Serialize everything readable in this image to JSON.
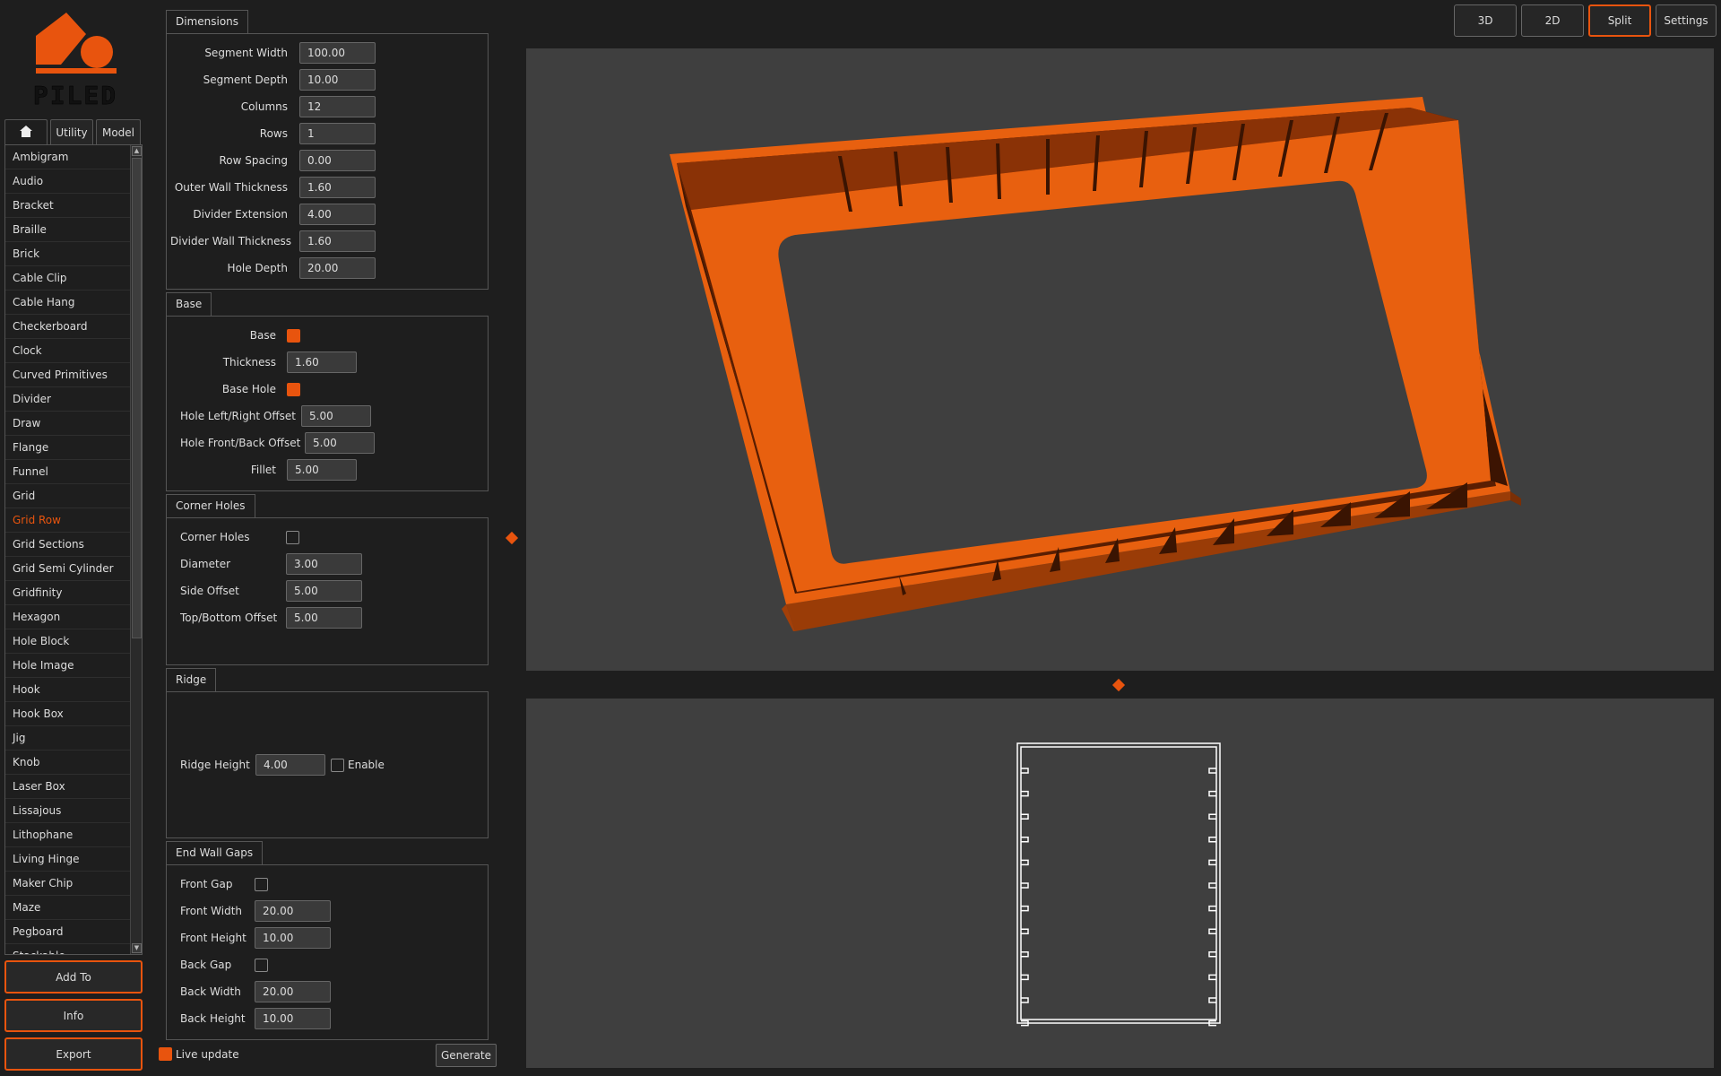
{
  "app": {
    "logo_text": "PILED"
  },
  "colors": {
    "accent": "#e8540e",
    "background": "#1e1e1e",
    "viewport": "#3f3f3f"
  },
  "tabs": {
    "home_icon": "home-icon",
    "utility": "Utility",
    "model": "Model"
  },
  "model_list": {
    "selected": "Grid Row",
    "items": [
      "Ambigram",
      "Audio",
      "Bracket",
      "Braille",
      "Brick",
      "Cable Clip",
      "Cable Hang",
      "Checkerboard",
      "Clock",
      "Curved Primitives",
      "Divider",
      "Draw",
      "Flange",
      "Funnel",
      "Grid",
      "Grid Row",
      "Grid Sections",
      "Grid Semi Cylinder",
      "Gridfinity",
      "Hexagon",
      "Hole Block",
      "Hole Image",
      "Hook",
      "Hook Box",
      "Jig",
      "Knob",
      "Laser Box",
      "Lissajous",
      "Lithophane",
      "Living Hinge",
      "Maker Chip",
      "Maze",
      "Pegboard",
      "Stackable"
    ]
  },
  "side_buttons": {
    "add_to": "Add To",
    "info": "Info",
    "export": "Export"
  },
  "dimensions": {
    "title": "Dimensions",
    "fields": [
      {
        "label": "Segment Width",
        "value": "100.00"
      },
      {
        "label": "Segment Depth",
        "value": "10.00"
      },
      {
        "label": "Columns",
        "value": "12"
      },
      {
        "label": "Rows",
        "value": "1"
      },
      {
        "label": "Row Spacing",
        "value": "0.00"
      },
      {
        "label": "Outer Wall Thickness",
        "value": "1.60"
      },
      {
        "label": "Divider Extension",
        "value": "4.00"
      },
      {
        "label": "Divider Wall Thickness",
        "value": "1.60"
      },
      {
        "label": "Hole Depth",
        "value": "20.00"
      }
    ]
  },
  "base": {
    "title": "Base",
    "base_label": "Base",
    "base_checked": true,
    "thickness_label": "Thickness",
    "thickness_value": "1.60",
    "base_hole_label": "Base Hole",
    "base_hole_checked": true,
    "lr_offset_label": "Hole Left/Right Offset",
    "lr_offset_value": "5.00",
    "fb_offset_label": "Hole Front/Back Offset",
    "fb_offset_value": "5.00",
    "fillet_label": "Fillet",
    "fillet_value": "5.00"
  },
  "corner_holes": {
    "title": "Corner Holes",
    "enable_label": "Corner Holes",
    "enabled": false,
    "diameter_label": "Diameter",
    "diameter_value": "3.00",
    "side_offset_label": "Side Offset",
    "side_offset_value": "5.00",
    "tb_offset_label": "Top/Bottom Offset",
    "tb_offset_value": "5.00"
  },
  "ridge": {
    "title": "Ridge",
    "height_label": "Ridge Height",
    "height_value": "4.00",
    "enable_label": "Enable",
    "enabled": false
  },
  "end_wall_gaps": {
    "title": "End Wall Gaps",
    "front_gap_label": "Front Gap",
    "front_gap": false,
    "front_width_label": "Front Width",
    "front_width_value": "20.00",
    "front_height_label": "Front Height",
    "front_height_value": "10.00",
    "back_gap_label": "Back Gap",
    "back_gap": false,
    "back_width_label": "Back Width",
    "back_width_value": "20.00",
    "back_height_label": "Back Height",
    "back_height_value": "10.00"
  },
  "footer": {
    "live_update_label": "Live update",
    "live_update": true,
    "generate": "Generate"
  },
  "view_buttons": {
    "b3d": "3D",
    "b2d": "2D",
    "split": "Split",
    "settings": "Settings",
    "active": "Split"
  }
}
